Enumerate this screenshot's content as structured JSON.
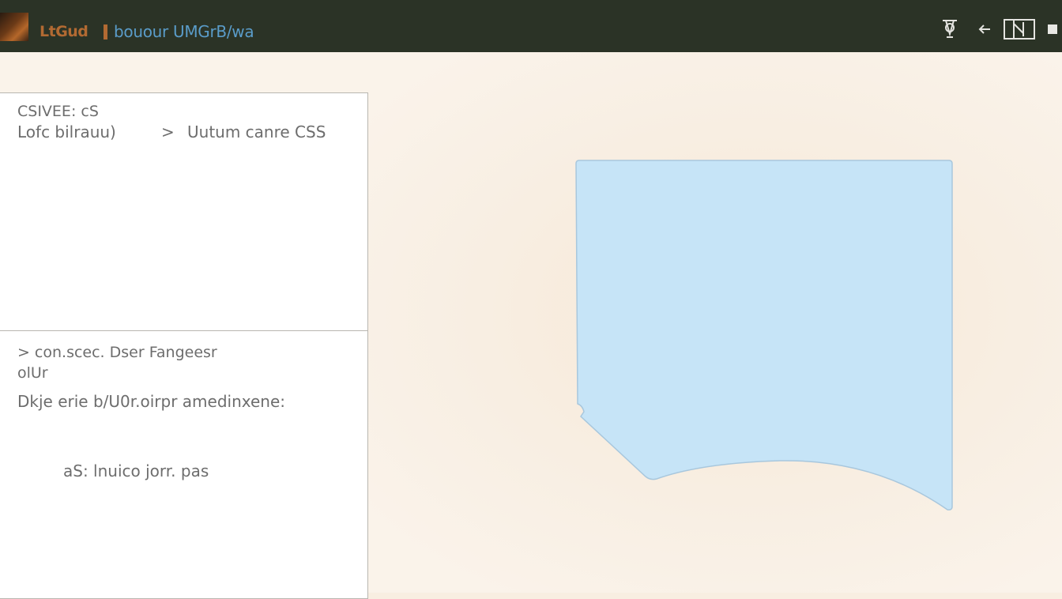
{
  "titlebar": {
    "logo_text": "LtGud",
    "title": "bouour UMGrB/wa",
    "icons": [
      "pen-icon",
      "back-arrow-icon",
      "screen-icon",
      "stop-icon"
    ]
  },
  "panel_top": {
    "settings_label": "CSIVEE: cS",
    "path_label": "Lofc bilrauu)",
    "arrow": ">",
    "target_label": "Uutum canre CSS"
  },
  "panel_bottom": {
    "consec_arrow": ">",
    "consec_label": "con.scec.  Dser Fangeesr",
    "output_label": "olUr",
    "description": "Dkje erie b/U0r.oirpr amedinxene:",
    "info": "aS: lnuico jorr.  pas"
  },
  "colors": {
    "titlebar_bg": "#2b3326",
    "logo": "#b26a32",
    "title": "#5a9cc9",
    "preview_fill": "#c6e4f7",
    "preview_border": "#a8c7dd",
    "workspace_bg": "#f8eee1"
  }
}
